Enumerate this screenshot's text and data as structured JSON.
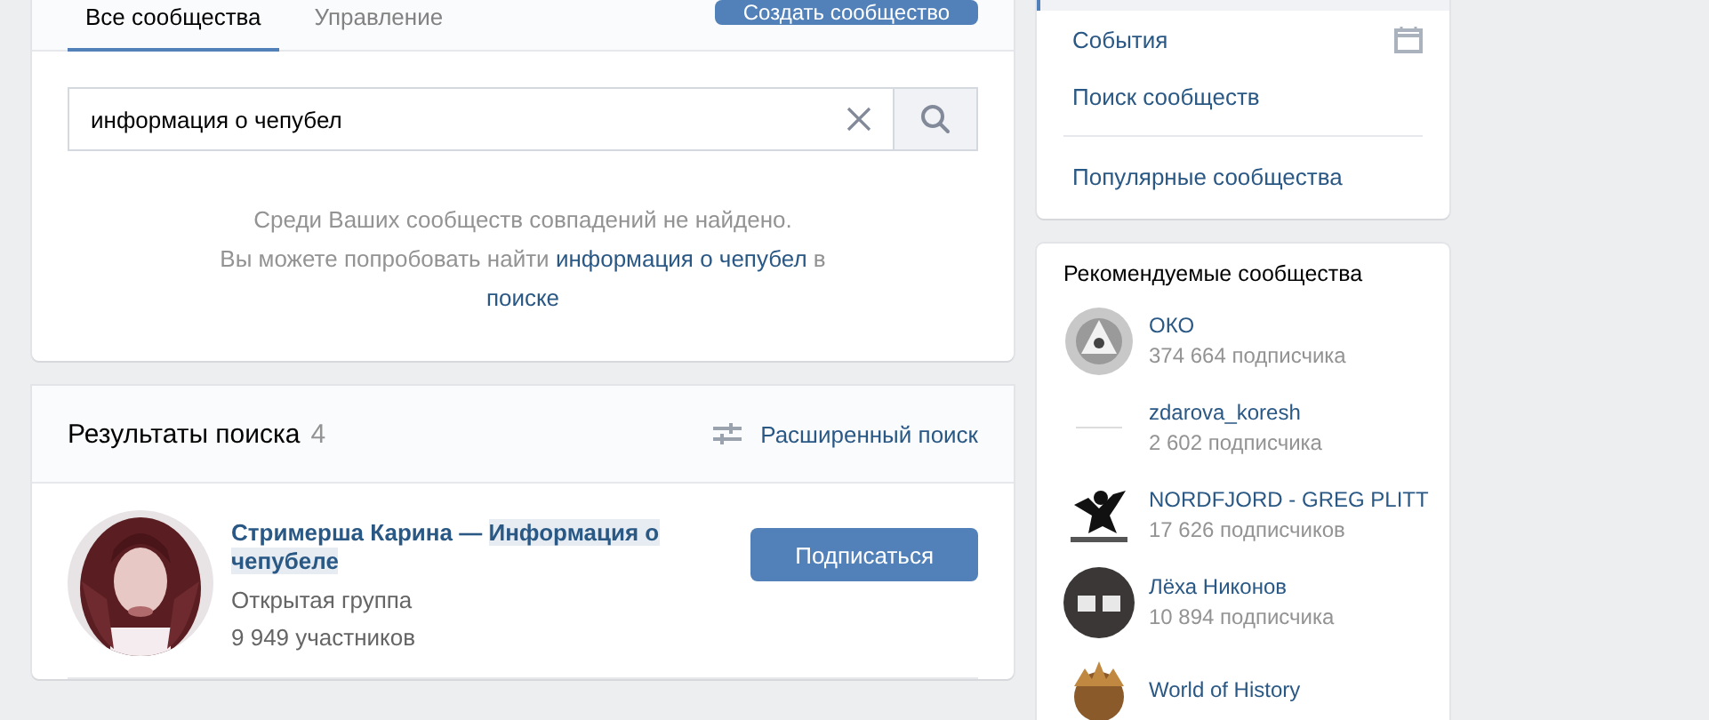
{
  "tabs": [
    {
      "label": "Все сообщества",
      "selected": true
    },
    {
      "label": "Управление",
      "selected": false
    }
  ],
  "create_button": "Создать сообщество",
  "search": {
    "value": "информация о чепубел"
  },
  "empty_message": {
    "line1": "Среди Ваших сообществ совпадений не найдено.",
    "before": "Вы можете попробовать найти",
    "link": "информация о чепубел",
    "after": "в",
    "link2": "поиске"
  },
  "results": {
    "title": "Результаты поиска",
    "count": "4",
    "advanced": "Расширенный поиск",
    "items": [
      {
        "name_parts": [
          {
            "text": "Стримерша Карина — ",
            "highlighted": false
          },
          {
            "text": "Информация о чепубеле",
            "highlighted": true
          }
        ],
        "type": "Открытая группа",
        "members": "9 949 участников",
        "button": "Подписаться"
      }
    ]
  },
  "menu": [
    {
      "label": "События",
      "kind": "calendar"
    },
    {
      "label": "Поиск сообществ",
      "kind": "plain"
    },
    {
      "kind": "divider"
    },
    {
      "label": "Популярные сообщества",
      "kind": "plain"
    }
  ],
  "recommended": {
    "title": "Рекомендуемые сообщества",
    "items": [
      {
        "name": "ОКО",
        "subscribers": "374 664 подписчика"
      },
      {
        "name": "zdarova_koresh",
        "subscribers": "2 602 подписчика"
      },
      {
        "name": "NORDFJORD - GREG PLITT",
        "subscribers": "17 626 подписчиков"
      },
      {
        "name": "Лёха Никонов",
        "subscribers": "10 894 подписчика"
      },
      {
        "name": "World of History"
      }
    ]
  }
}
